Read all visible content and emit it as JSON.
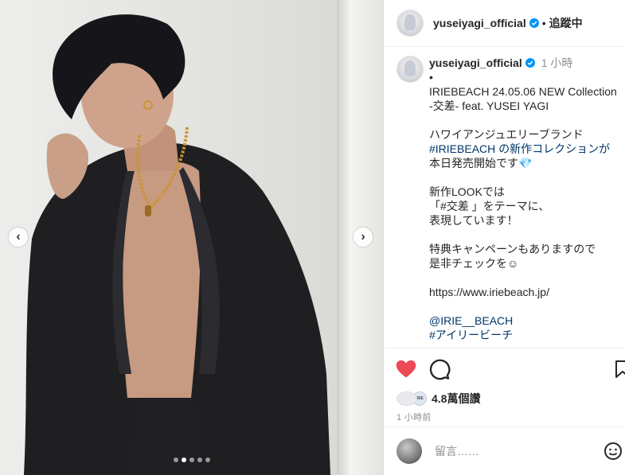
{
  "post": {
    "username": "yuseiyagi_official",
    "follow_state": "追蹤中",
    "separator": "•",
    "time_ago": "1 小時"
  },
  "caption": {
    "lines": [
      "IRIEBEACH 24.05.06 NEW Collection",
      "-交差- feat. YUSEI YAGI",
      "",
      "ハワイアンジュエリーブランド",
      "#IRIEBEACH の新作コレクションが",
      "本日発売開始です💎",
      "",
      "新作LOOKでは",
      "「#交差 」をテーマに、",
      "表現しています！",
      "",
      "特典キャンペーンもありますので",
      "是非チェックを☺",
      "",
      "https://www.iriebeach.jp/",
      "",
      "@IRIE__BEACH",
      "#アイリービーチ"
    ]
  },
  "stats": {
    "views": "4.8萬個讚",
    "posted": "1 小時前",
    "mini_avatar_text": "IRIE"
  },
  "comment": {
    "placeholder": "留言……"
  },
  "carousel": {
    "prev": "‹",
    "next": "›",
    "slides": 5,
    "active": 1
  },
  "colors": {
    "like": "#ed4956",
    "verified": "#0095f6",
    "hashtag": "#00376b"
  }
}
